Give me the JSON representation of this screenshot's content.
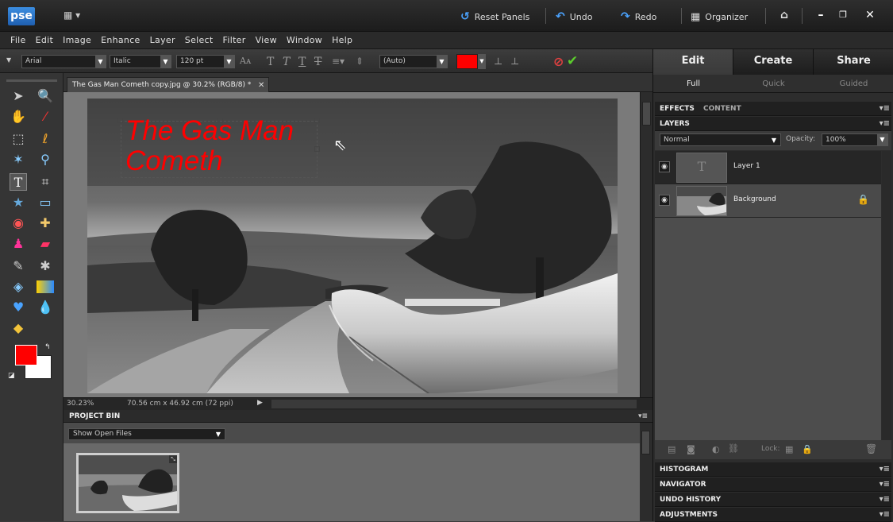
{
  "app": {
    "logo_text": "pse"
  },
  "titlebar": {
    "reset_panels": "Reset Panels",
    "undo": "Undo",
    "redo": "Redo",
    "organizer": "Organizer"
  },
  "menu": [
    "File",
    "Edit",
    "Image",
    "Enhance",
    "Layer",
    "Select",
    "Filter",
    "View",
    "Window",
    "Help"
  ],
  "options": {
    "font": "Arial",
    "style": "Italic",
    "size": "120 pt",
    "leading": "(Auto)",
    "text_color": "#ff0000"
  },
  "document": {
    "tab_title": "The Gas Man Cometh copy.jpg @ 30.2% (RGB/8) *",
    "text_layer_line1": "The Gas Man",
    "text_layer_line2": "Cometh",
    "text_color": "#ff0000"
  },
  "status": {
    "zoom": "30.23%",
    "doc_size": "70.56 cm x 46.92 cm (72 ppi)"
  },
  "project_bin": {
    "title": "PROJECT BIN",
    "filter": "Show Open Files"
  },
  "panel": {
    "tabs": [
      "Edit",
      "Create",
      "Share"
    ],
    "subtabs": [
      "Full",
      "Quick",
      "Guided"
    ],
    "effects_label": "EFFECTS",
    "content_label": "CONTENT",
    "layers_label": "LAYERS",
    "blend_mode": "Normal",
    "opacity_label": "Opacity:",
    "opacity_value": "100%",
    "layers": [
      {
        "name": "Layer 1"
      },
      {
        "name": "Background"
      }
    ],
    "lock_label": "Lock:",
    "collapsed": [
      "HISTOGRAM",
      "NAVIGATOR",
      "UNDO HISTORY",
      "ADJUSTMENTS"
    ]
  },
  "colors": {
    "foreground": "#ff0000",
    "background": "#ffffff",
    "accent": "#4aa3ff"
  }
}
